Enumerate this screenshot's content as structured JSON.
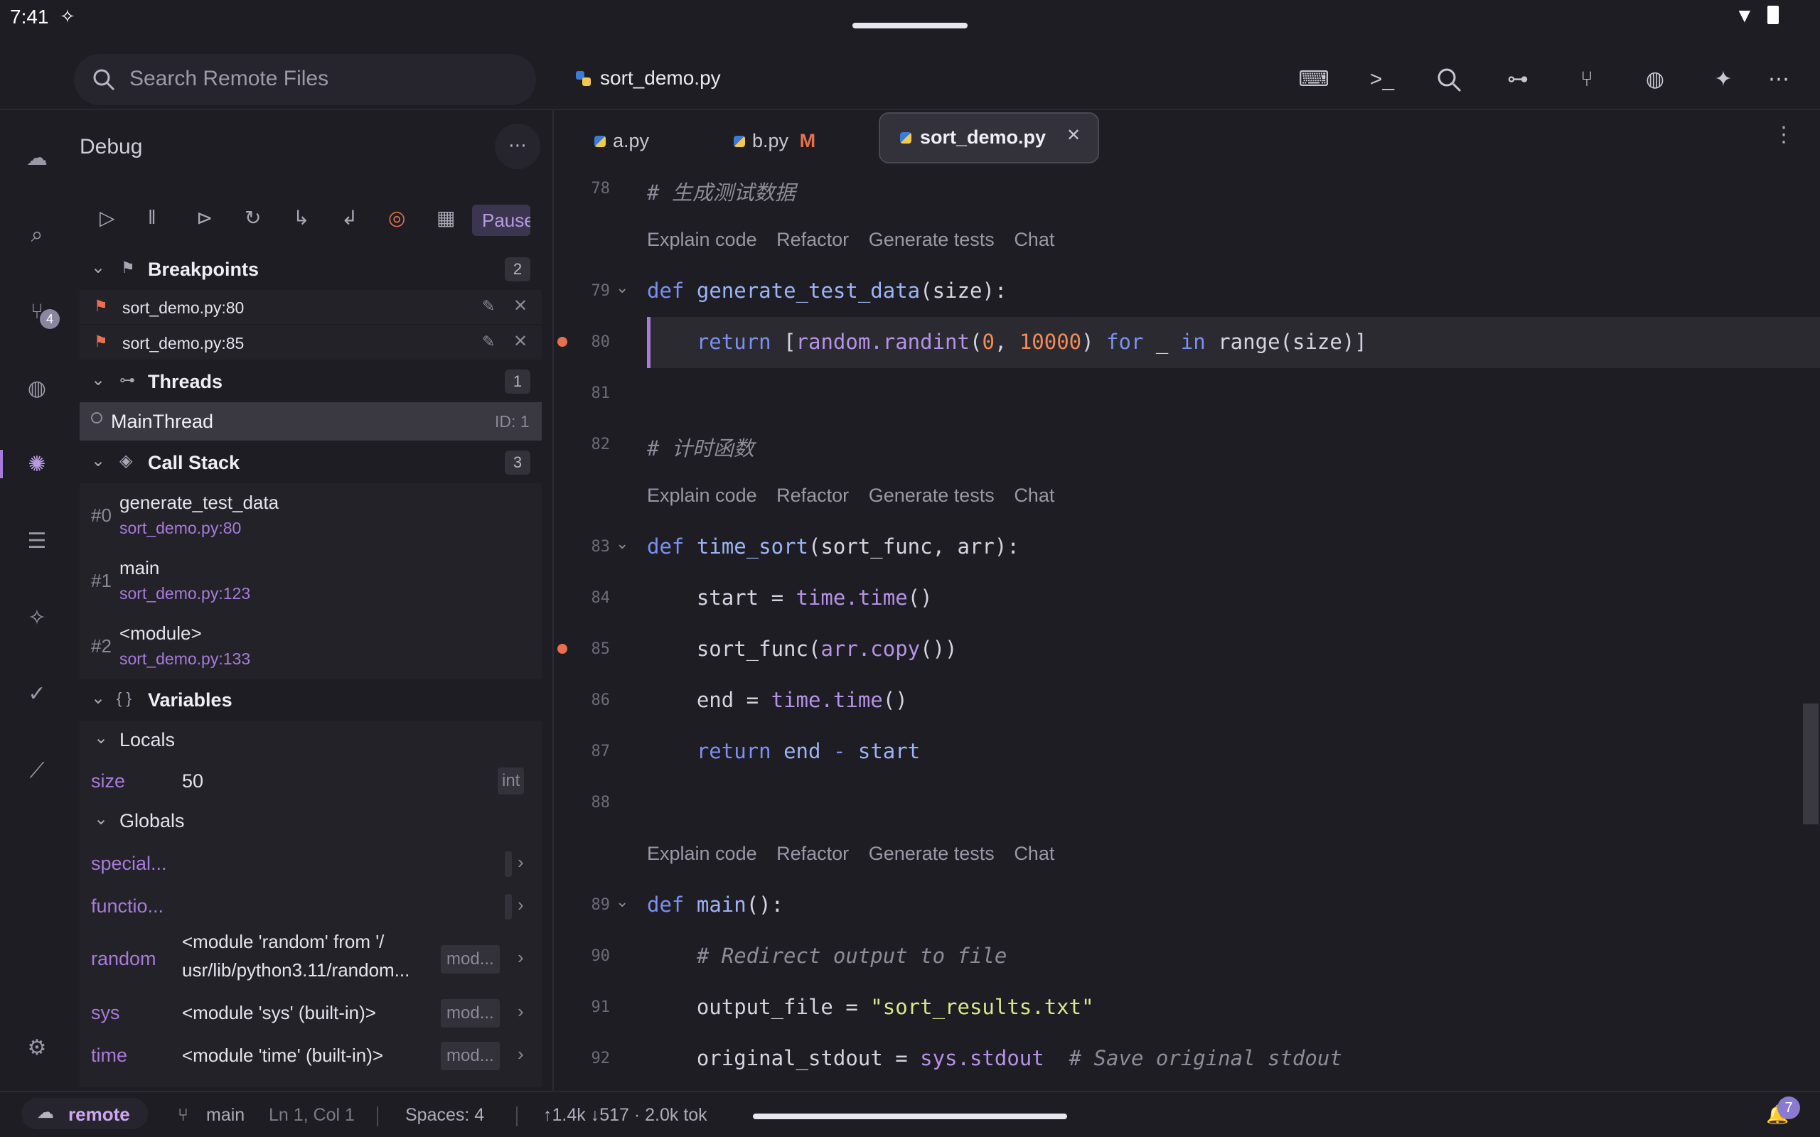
{
  "system": {
    "time": "7:41"
  },
  "topbar": {
    "search_placeholder": "Search Remote Files",
    "active_file": "sort_demo.py",
    "icons": [
      "keyboard-icon",
      "terminal-icon",
      "search-icon",
      "graph-icon",
      "branch-icon",
      "globe-icon",
      "sparkle-icon",
      "more-icon"
    ]
  },
  "activity": {
    "scm_badge": "4"
  },
  "sidebar": {
    "title": "Debug",
    "pause_label": "Pause",
    "breakpoints": {
      "title": "Breakpoints",
      "count": "2",
      "items": [
        {
          "label": "sort_demo.py:80"
        },
        {
          "label": "sort_demo.py:85"
        }
      ]
    },
    "threads": {
      "title": "Threads",
      "count": "1",
      "items": [
        {
          "name": "MainThread",
          "id": "ID: 1"
        }
      ]
    },
    "callstack": {
      "title": "Call Stack",
      "count": "3",
      "frames": [
        {
          "index": "#0",
          "name": "generate_test_data",
          "loc": "sort_demo.py:80"
        },
        {
          "index": "#1",
          "name": "main",
          "loc": "sort_demo.py:123"
        },
        {
          "index": "#2",
          "name": "<module>",
          "loc": "sort_demo.py:133"
        }
      ]
    },
    "variables": {
      "title": "Variables",
      "locals_label": "Locals",
      "globals_label": "Globals",
      "locals": [
        {
          "name": "size",
          "value": "50",
          "type": "int"
        }
      ],
      "globals": [
        {
          "name": "special...",
          "value": "",
          "type": ""
        },
        {
          "name": "functio...",
          "value": "",
          "type": ""
        },
        {
          "name": "random",
          "value": "<module 'random' from '/",
          "value2": "usr/lib/python3.11/random...",
          "type": "mod..."
        },
        {
          "name": "sys",
          "value": "<module 'sys' (built-in)>",
          "type": "mod..."
        },
        {
          "name": "time",
          "value": "<module 'time' (built-in)>",
          "type": "mod..."
        }
      ]
    }
  },
  "editor": {
    "tabs": [
      {
        "label": "a.py",
        "modified": ""
      },
      {
        "label": "b.py",
        "modified": "M"
      },
      {
        "label": "sort_demo.py",
        "modified": ""
      }
    ],
    "lens": {
      "explain": "Explain code",
      "refactor": "Refactor",
      "tests": "Generate tests",
      "chat": "Chat"
    },
    "lines": [
      {
        "n": "78",
        "text": "# 生成测试数据"
      },
      {
        "n": "79",
        "text": "def generate_test_data(size):"
      },
      {
        "n": "80",
        "text": "    return [random.randint(0, 10000) for _ in range(size)]"
      },
      {
        "n": "81",
        "text": ""
      },
      {
        "n": "82",
        "text": "# 计时函数"
      },
      {
        "n": "83",
        "text": "def time_sort(sort_func, arr):"
      },
      {
        "n": "84",
        "text": "    start = time.time()"
      },
      {
        "n": "85",
        "text": "    sort_func(arr.copy())"
      },
      {
        "n": "86",
        "text": "    end = time.time()"
      },
      {
        "n": "87",
        "text": "    return end - start"
      },
      {
        "n": "88",
        "text": ""
      },
      {
        "n": "89",
        "text": "def main():"
      },
      {
        "n": "90",
        "text": "    # Redirect output to file"
      },
      {
        "n": "91",
        "text": "    output_file = \"sort_results.txt\""
      },
      {
        "n": "92",
        "text": "    original_stdout = sys.stdout  # Save original stdout"
      }
    ]
  },
  "statusbar": {
    "remote": "remote",
    "branch": "main",
    "position": "Ln 1, Col 1",
    "spaces": "Spaces: 4",
    "tokens": "↑1.4k ↓517 · 2.0k tok",
    "notifications": "7"
  }
}
